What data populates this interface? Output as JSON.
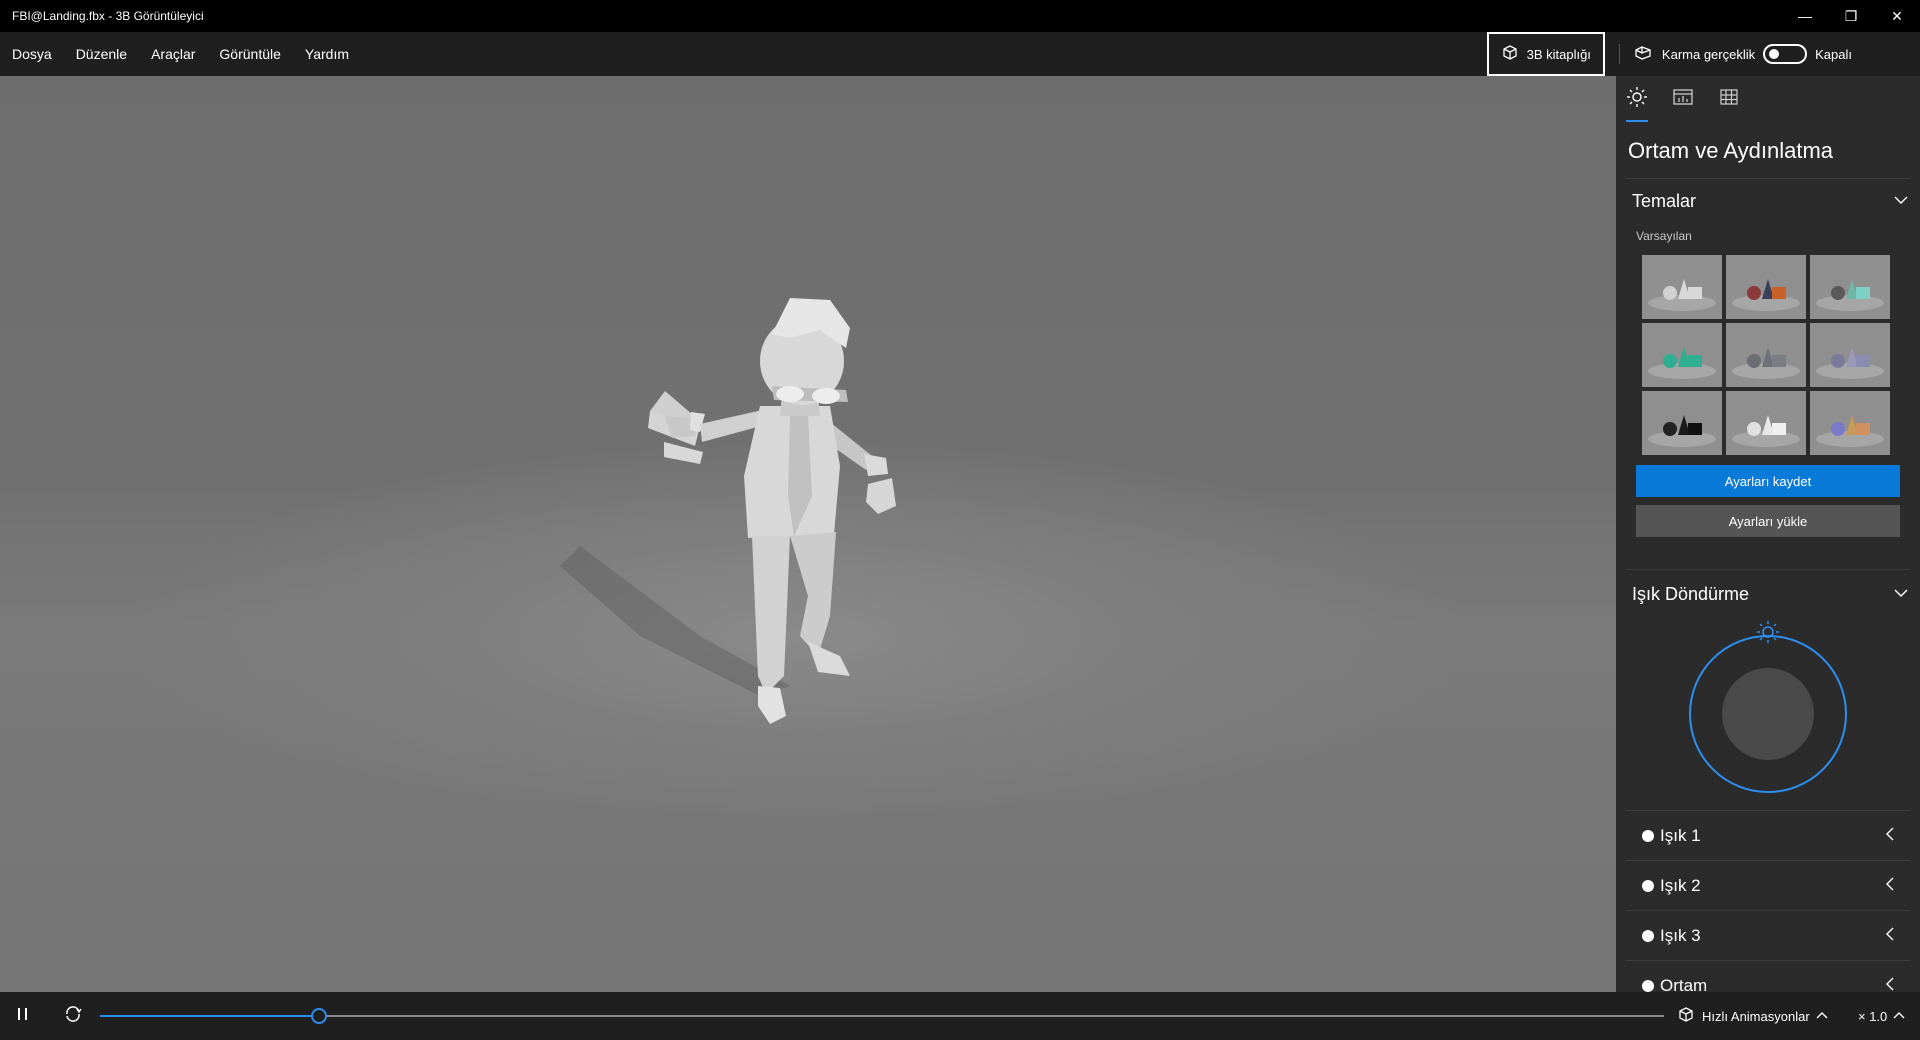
{
  "window": {
    "title": "FBI@Landing.fbx - 3B Görüntüleyici",
    "minimize_glyph": "—",
    "restore_glyph": "❐",
    "close_glyph": "✕"
  },
  "menu": {
    "items": [
      "Dosya",
      "Düzenle",
      "Araçlar",
      "Görüntüle",
      "Yardım"
    ],
    "library_button": "3B kitaplığı",
    "mixed_reality_label": "Karma gerçeklik",
    "mixed_reality_state": "Kapalı"
  },
  "panel": {
    "tabs": [
      {
        "icon": "sun-icon",
        "active": true
      },
      {
        "icon": "stats-icon",
        "active": false
      },
      {
        "icon": "grid-icon",
        "active": false
      }
    ],
    "title": "Ortam ve Aydınlatma",
    "themes_section": {
      "label": "Temalar",
      "sub_label": "Varsayılan",
      "themes": [
        {
          "bg": "#8f8f8f",
          "shape1": "#d8d8d8",
          "shape2": "#d8d8d8",
          "shape3": "#d0d0d0",
          "selected": true
        },
        {
          "bg": "#8f8f8f",
          "shape1": "#3a3f5a",
          "shape2": "#c8602a",
          "shape3": "#8a3a3a",
          "selected": false
        },
        {
          "bg": "#8f8f8f",
          "shape1": "#6fb6a8",
          "shape2": "#7fd0c4",
          "shape3": "#5a5a5a",
          "selected": false
        },
        {
          "bg": "#8f8f8f",
          "shape1": "#2fae92",
          "shape2": "#2fae92",
          "shape3": "#2fae92",
          "selected": false
        },
        {
          "bg": "#8f8f8f",
          "shape1": "#6e7278",
          "shape2": "#7a7e84",
          "shape3": "#6a6e74",
          "selected": false
        },
        {
          "bg": "#8f8f8f",
          "shape1": "#9a9ab8",
          "shape2": "#8c8cb0",
          "shape3": "#7a7a9a",
          "selected": false
        },
        {
          "bg": "#8f8f8f",
          "shape1": "#1a1a1a",
          "shape2": "#111111",
          "shape3": "#222222",
          "selected": false
        },
        {
          "bg": "#8f8f8f",
          "shape1": "#e8e8e8",
          "shape2": "#f0f0f0",
          "shape3": "#e0e0e0",
          "selected": false
        },
        {
          "bg": "#8f8f8f",
          "shape1": "#c89a5a",
          "shape2": "#d09060",
          "shape3": "#7a7ac8",
          "selected": false
        }
      ],
      "save_button": "Ayarları kaydet",
      "load_button": "Ayarları yükle"
    },
    "light_rotation_section": {
      "label": "Işık Döndürme"
    },
    "lights": [
      {
        "label": "Işık 1"
      },
      {
        "label": "Işık 2"
      },
      {
        "label": "Işık 3"
      },
      {
        "label": "Ortam"
      }
    ]
  },
  "playback": {
    "progress": 0.14,
    "quick_animations_label": "Hızlı Animasyonlar",
    "speed_label": "× 1.0"
  },
  "colors": {
    "accent": "#2c8ff0",
    "primary_button": "#0a7ad8",
    "panel_bg": "#2b2b2b",
    "bar_bg": "#1f1f1f",
    "model": "#d9d9d9"
  }
}
